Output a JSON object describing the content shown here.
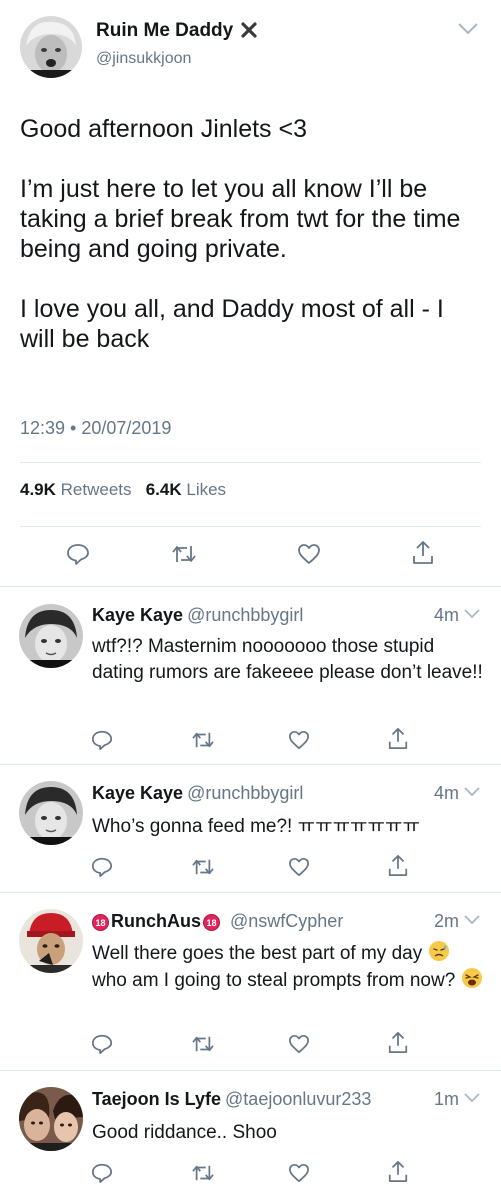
{
  "main_tweet": {
    "author_name": "Ruin Me Daddy",
    "handle": "@jinsukkjoon",
    "paragraphs": [
      "Good afternoon Jinlets <3",
      "I’m just here to let you all know I’ll be taking a brief break from twt for the time being and going private.",
      "I love you all, and Daddy most of all - I will be back"
    ],
    "timestamp": "12:39 • 20/07/2019",
    "retweets_count": "4.9K",
    "retweets_label": "Retweets",
    "likes_count": "6.4K",
    "likes_label": "Likes"
  },
  "replies": [
    {
      "name": "Kaye Kaye",
      "handle": "@runchbbygirl",
      "time": "4m",
      "text": "wtf?!? Masternim nooooooo those stupid dating rumors are fakeeee please don’t leave!!"
    },
    {
      "name": "Kaye Kaye",
      "handle": "@runchbbygirl",
      "time": "4m",
      "text": "Who’s gonna feed me?! ㅠㅠㅠㅠㅠㅠㅠ"
    },
    {
      "name": "RunchAus",
      "badge": "18",
      "handle": "@nswfCypher",
      "time": "2m",
      "text_a": "Well there goes the best part of my day",
      "text_b": " who am I going to steal prompts from now? "
    },
    {
      "name": "Taejoon Is Lyfe",
      "handle": "@taejoonluvur233",
      "time": "1m",
      "text": "Good riddance.. Shoo"
    }
  ],
  "icons": [
    "verified-x-icon",
    "chevron-down-icon",
    "reply-icon",
    "retweet-icon",
    "like-icon",
    "share-icon",
    "sad-sweat-emoji",
    "weary-emoji"
  ],
  "colors": {
    "text": "#14171a",
    "secondary": "#657786",
    "divider": "#e1e8ed",
    "badge": "#e0245e"
  }
}
